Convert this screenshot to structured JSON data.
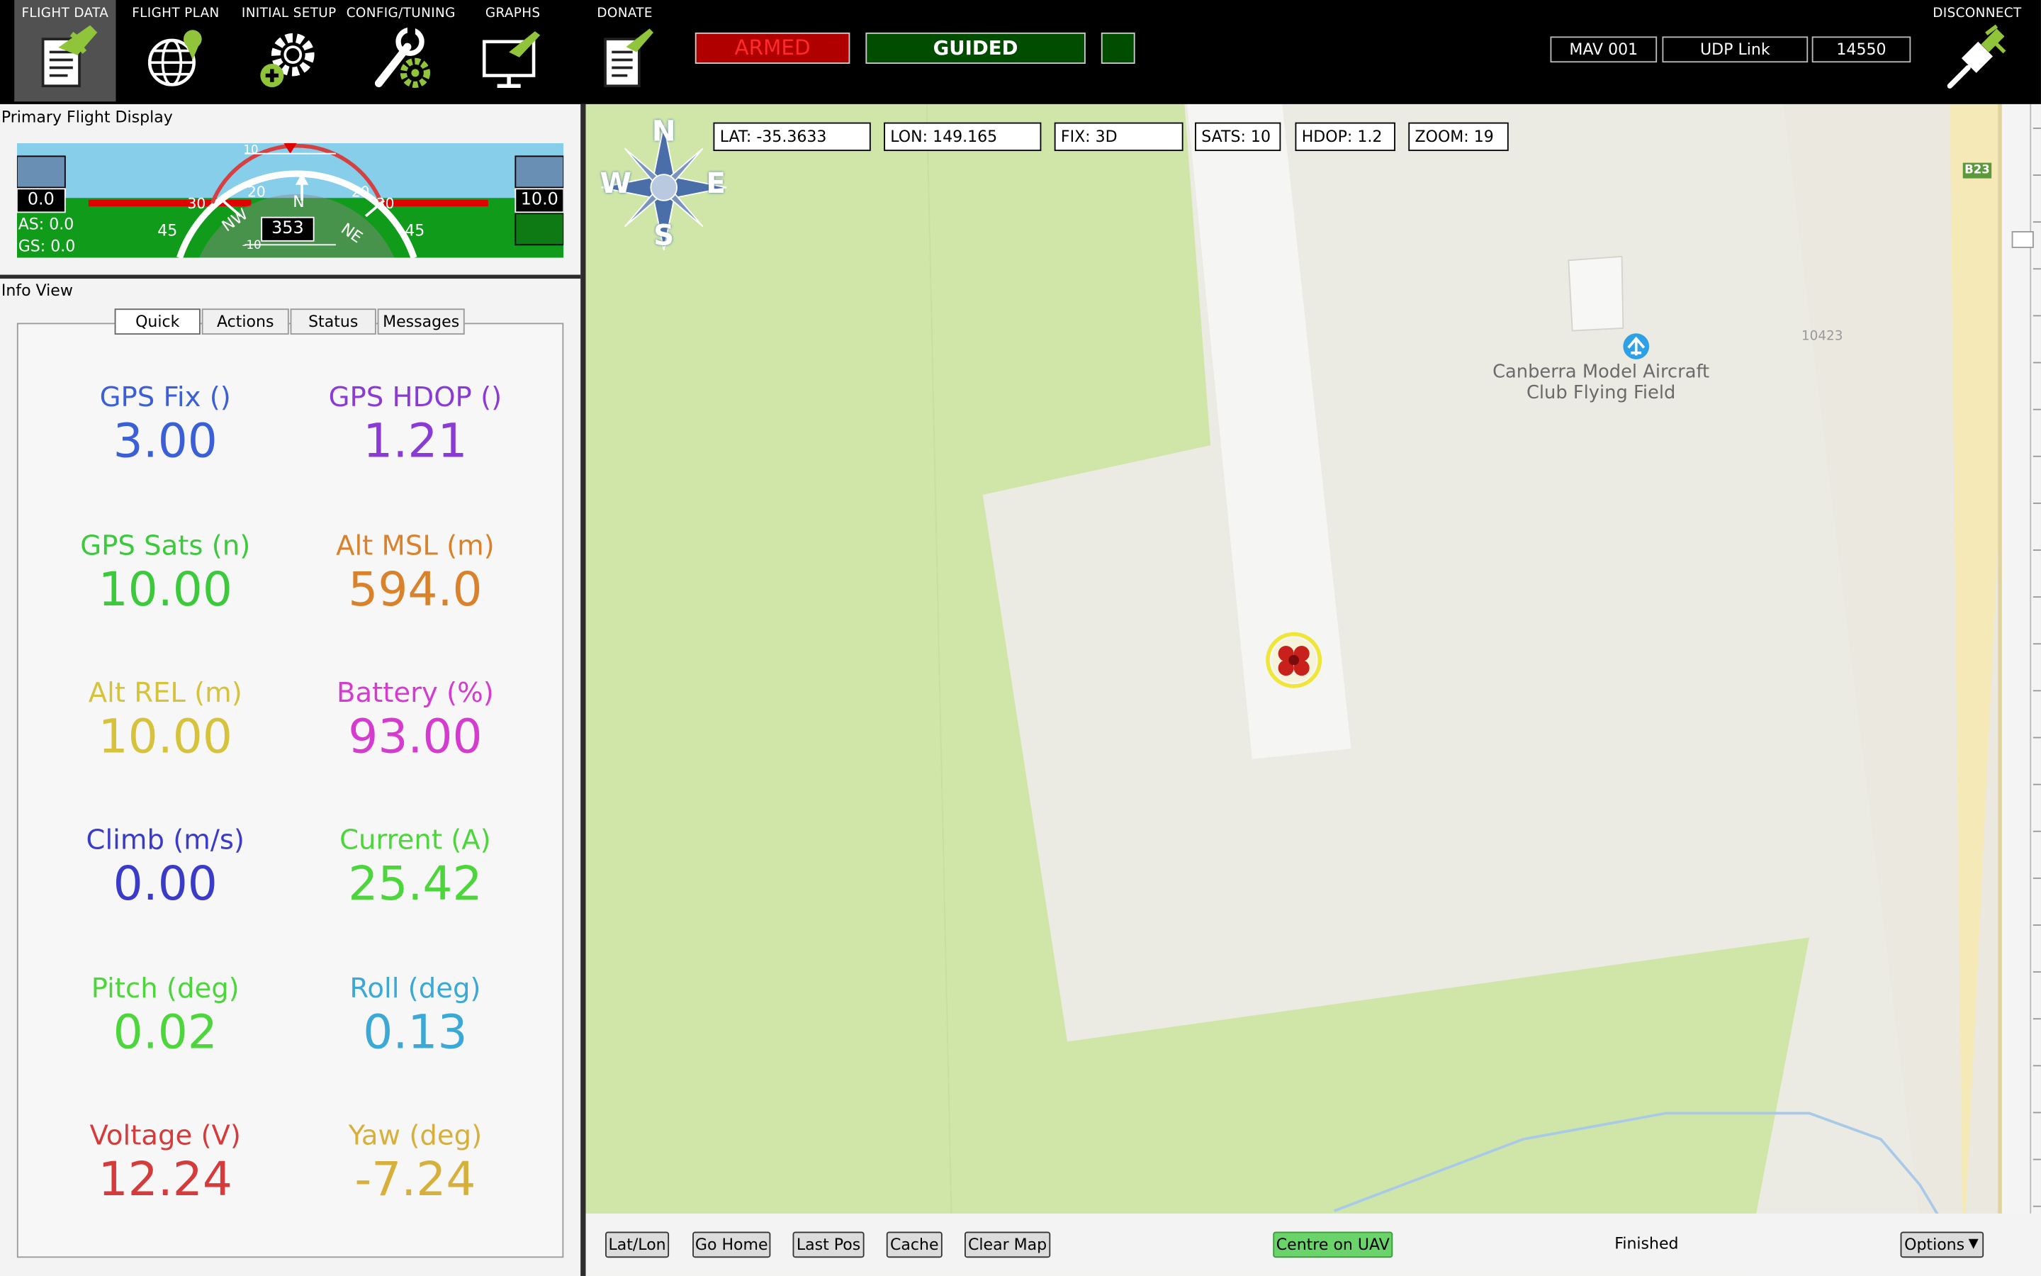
{
  "menu": [
    {
      "label": "FLIGHT DATA",
      "icon": "flight-data-icon",
      "active": true
    },
    {
      "label": "FLIGHT PLAN",
      "icon": "flight-plan-icon"
    },
    {
      "label": "INITIAL SETUP",
      "icon": "initial-setup-icon"
    },
    {
      "label": "CONFIG/TUNING",
      "icon": "config-tuning-icon"
    },
    {
      "label": "GRAPHS",
      "icon": "graphs-icon"
    },
    {
      "label": "DONATE",
      "icon": "donate-icon"
    }
  ],
  "status": {
    "armed": "ARMED",
    "mode": "GUIDED",
    "extra": ""
  },
  "connection": {
    "mav": "MAV 001",
    "link": "UDP Link",
    "port": "14550",
    "disconnect_label": "DISCONNECT"
  },
  "pfd": {
    "title": "Primary Flight Display",
    "left_value": "0.0",
    "right_value": "10.0",
    "airspeed": "AS: 0.0",
    "groundspeed": "GS: 0.0",
    "heading": "353",
    "compass_labels": {
      "n": "N",
      "nw": "NW",
      "ne": "NE"
    },
    "pitch_labels": [
      "10",
      "-10",
      "45",
      "45"
    ],
    "scale_labels": [
      "20",
      "20",
      "30",
      "30"
    ]
  },
  "info_view": {
    "title": "Info View",
    "tabs": [
      "Quick",
      "Actions",
      "Status",
      "Messages"
    ],
    "quick": [
      {
        "label": "GPS Fix ()",
        "value": "3.00",
        "color": "#3b5fd6"
      },
      {
        "label": "GPS HDOP ()",
        "value": "1.21",
        "color": "#8a3bd6"
      },
      {
        "label": "GPS Sats (n)",
        "value": "10.00",
        "color": "#3cc93c"
      },
      {
        "label": "Alt MSL (m)",
        "value": "594.0",
        "color": "#d9822b"
      },
      {
        "label": "Alt REL (m)",
        "value": "10.00",
        "color": "#d6c23b"
      },
      {
        "label": "Battery (%)",
        "value": "93.00",
        "color": "#d63bd0"
      },
      {
        "label": "Climb (m/s)",
        "value": "0.00",
        "color": "#3b3bc9"
      },
      {
        "label": "Current (A)",
        "value": "25.42",
        "color": "#4cd63b"
      },
      {
        "label": "Pitch (deg)",
        "value": "0.02",
        "color": "#4cd63b"
      },
      {
        "label": "Roll (deg)",
        "value": "0.13",
        "color": "#3ba8d6"
      },
      {
        "label": "Voltage (V)",
        "value": "12.24",
        "color": "#d63b3b"
      },
      {
        "label": "Yaw (deg)",
        "value": "-7.24",
        "color": "#d6b03b"
      }
    ]
  },
  "map": {
    "lat": "LAT: -35.3633",
    "lon": "LON: 149.165",
    "fix": "FIX: 3D",
    "sats": "SATS: 10",
    "hdop": "HDOP: 1.2",
    "zoom": "ZOOM: 19",
    "compass": {
      "n": "N",
      "s": "S",
      "e": "E",
      "w": "W"
    },
    "place_line1": "Canberra Model Aircraft",
    "place_line2": "Club Flying Field",
    "parcel": "10423",
    "road": "B23"
  },
  "map_controls": {
    "latlon": "Lat/Lon",
    "go_home": "Go Home",
    "last_pos": "Last Pos",
    "cache": "Cache",
    "clear_map": "Clear Map",
    "centre": "Centre on UAV",
    "status": "Finished",
    "options": "Options"
  }
}
